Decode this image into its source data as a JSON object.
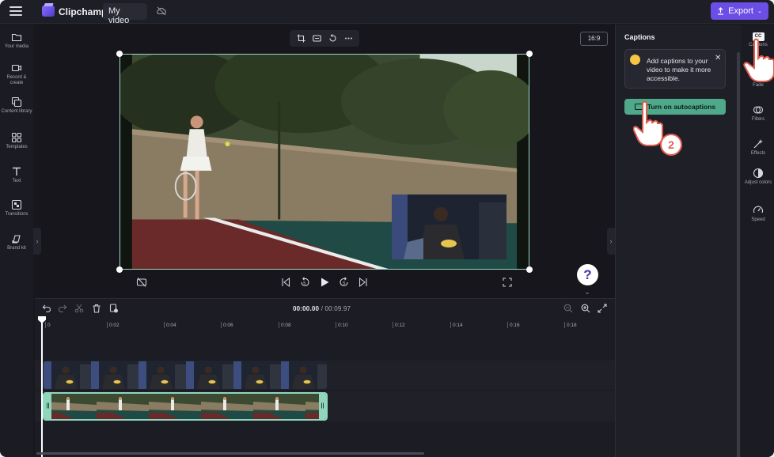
{
  "topbar": {
    "app_name": "Clipchamp",
    "project_title": "My video",
    "export_label": "Export"
  },
  "sidebar": {
    "items": [
      {
        "label": "Your media",
        "icon": "folder-icon"
      },
      {
        "label": "Record & create",
        "icon": "camera-icon"
      },
      {
        "label": "Content library",
        "icon": "library-icon"
      },
      {
        "label": "Templates",
        "icon": "templates-icon"
      },
      {
        "label": "Text",
        "icon": "text-icon"
      },
      {
        "label": "Transitions",
        "icon": "transitions-icon"
      },
      {
        "label": "Brand kit",
        "icon": "brand-kit-icon"
      }
    ]
  },
  "stage": {
    "aspect_ratio": "16:9",
    "help_label": "?"
  },
  "timeline": {
    "current_time": "00:00.00",
    "total_time": "/ 00:09.97",
    "ticks": [
      "0",
      "0:02",
      "0:04",
      "0:06",
      "0:08",
      "0:10",
      "0:12",
      "0:14",
      "0:16",
      "0:18"
    ]
  },
  "captions_panel": {
    "title": "Captions",
    "info_text": "Add captions to your video to make it more accessible.",
    "button_label": "Turn on autocaptions"
  },
  "rail": {
    "items": [
      {
        "label": "Captions",
        "icon": "cc-icon"
      },
      {
        "label": "Fade",
        "icon": "fade-icon"
      },
      {
        "label": "Filters",
        "icon": "filters-icon"
      },
      {
        "label": "Effects",
        "icon": "effects-icon"
      },
      {
        "label": "Adjust colors",
        "icon": "adjust-colors-icon"
      },
      {
        "label": "Speed",
        "icon": "speed-icon"
      }
    ],
    "cc_text": "CC"
  },
  "tutorial": {
    "step_number": "2"
  },
  "colors": {
    "accent": "#6b4ee6",
    "autocaptions": "#4fa88a",
    "selection": "#9fd8c5"
  }
}
